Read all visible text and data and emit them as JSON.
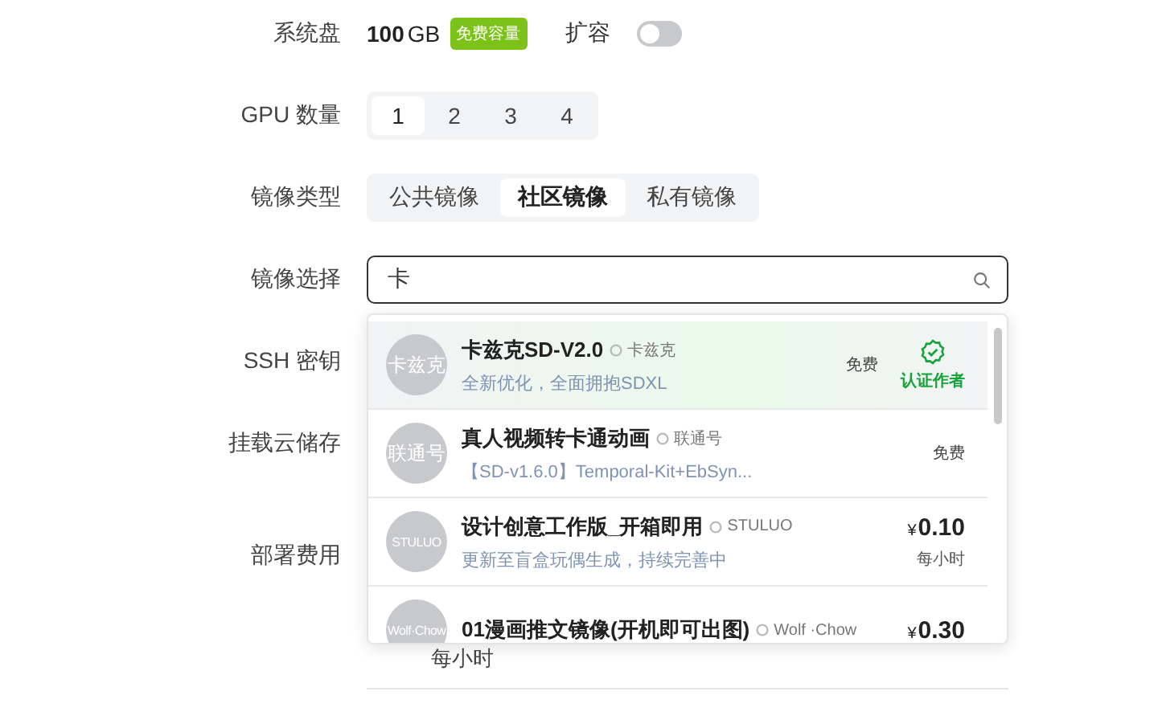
{
  "system_disk": {
    "label": "系统盘",
    "size": "100",
    "unit": "GB",
    "badge": "免费容量",
    "expand_label": "扩容",
    "expand_on": false
  },
  "gpu_count": {
    "label": "GPU 数量",
    "options": [
      {
        "label": "1",
        "selected": true
      },
      {
        "label": "2",
        "selected": false
      },
      {
        "label": "3",
        "selected": false
      },
      {
        "label": "4",
        "selected": false
      }
    ]
  },
  "image_type": {
    "label": "镜像类型",
    "options": [
      {
        "label": "公共镜像",
        "selected": false
      },
      {
        "label": "社区镜像",
        "selected": true
      },
      {
        "label": "私有镜像",
        "selected": false
      }
    ]
  },
  "image_select": {
    "label": "镜像选择",
    "value": "卡",
    "results": [
      {
        "selected": true,
        "avatar_text": "卡兹克",
        "title": "卡兹克SD-V2.0",
        "author": "卡兹克",
        "description": "全新优化，全面拥抱SDXL",
        "price": {
          "kind": "free",
          "text": "免费"
        },
        "verified": true,
        "verified_label": "认证作者"
      },
      {
        "selected": false,
        "avatar_text": "联通号",
        "title": "真人视频转卡通动画",
        "author": "联通号",
        "description": "【SD-v1.6.0】Temporal-Kit+EbSyn...",
        "price": {
          "kind": "free",
          "text": "免费"
        },
        "verified": false
      },
      {
        "selected": false,
        "avatar_text": "STULUO",
        "title": "设计创意工作版_开箱即用",
        "author": "STULUO",
        "description": "更新至盲盒玩偶生成，持续完善中",
        "price": {
          "kind": "paid",
          "currency": "¥",
          "amount": "0.10",
          "unit": "每小时"
        },
        "verified": false
      },
      {
        "selected": false,
        "avatar_text": "Wolf·Chow",
        "title": "01漫画推文镜像(开机即可出图)",
        "author": "Wolf ·Chow",
        "price": {
          "kind": "paid",
          "currency": "¥",
          "amount": "0.30"
        },
        "verified": false
      }
    ]
  },
  "ssh_key": {
    "label": "SSH 密钥"
  },
  "mount_storage": {
    "label": "挂载云储存"
  },
  "deploy_cost": {
    "label": "部署费用",
    "unit": "每小时"
  }
}
